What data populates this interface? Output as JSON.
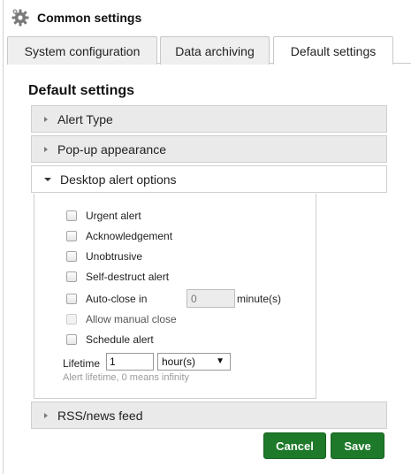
{
  "panel": {
    "title": "Common settings",
    "icon": "gear-icon"
  },
  "tabs": [
    {
      "label": "System configuration",
      "active": false
    },
    {
      "label": "Data archiving",
      "active": false
    },
    {
      "label": "Default settings",
      "active": true
    }
  ],
  "section": {
    "title": "Default settings"
  },
  "accordions": [
    {
      "label": "Alert Type",
      "open": false
    },
    {
      "label": "Pop-up appearance",
      "open": false
    },
    {
      "label": "Desktop alert options",
      "open": true
    },
    {
      "label": "RSS/news feed",
      "open": false
    }
  ],
  "desktop_options": {
    "checkboxes": [
      {
        "label": "Urgent alert",
        "checked": false,
        "disabled": false
      },
      {
        "label": "Acknowledgement",
        "checked": false,
        "disabled": false
      },
      {
        "label": "Unobtrusive",
        "checked": false,
        "disabled": false
      },
      {
        "label": "Self-destruct alert",
        "checked": false,
        "disabled": false
      },
      {
        "label": "Auto-close in",
        "checked": false,
        "disabled": false
      },
      {
        "label": "Allow manual close",
        "checked": false,
        "disabled": true
      },
      {
        "label": "Schedule alert",
        "checked": false,
        "disabled": false
      }
    ],
    "autoclose_value": "0",
    "autoclose_unit": "minute(s)",
    "lifetime_label": "Lifetime",
    "lifetime_value": "1",
    "lifetime_unit": "hour(s)",
    "lifetime_hint": "Alert lifetime, 0 means infinity"
  },
  "buttons": {
    "cancel": "Cancel",
    "save": "Save"
  },
  "colors": {
    "button_green": "#1e7a2a",
    "accordion_bg": "#eaeaea",
    "hint_gray": "#9a9a9a"
  }
}
